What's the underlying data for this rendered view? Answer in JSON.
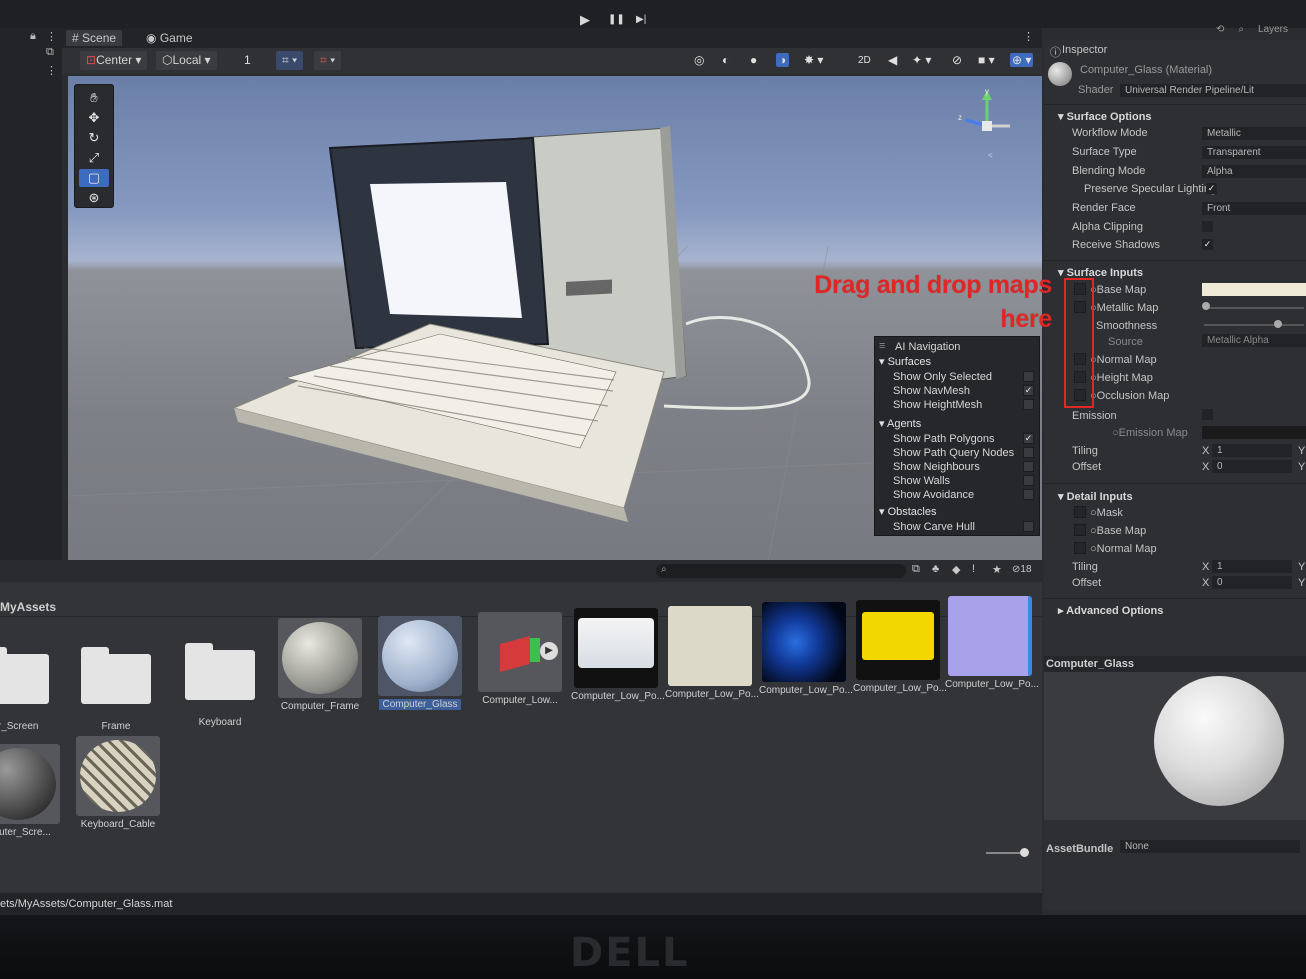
{
  "toolbar_top": {
    "play": "▶",
    "pause": "❚❚",
    "step": "▶|",
    "layers": "Layers"
  },
  "tabs": {
    "scene": "Scene",
    "game": "Game"
  },
  "scene_toolbar": {
    "pivot": "Center",
    "space": "Local",
    "grid_value": "1",
    "mode_2d": "2D"
  },
  "ai_navigation": {
    "title": "AI Navigation",
    "surfaces": "Surfaces",
    "surface_items": [
      {
        "label": "Show Only Selected",
        "checked": false
      },
      {
        "label": "Show NavMesh",
        "checked": true
      },
      {
        "label": "Show HeightMesh",
        "checked": false
      }
    ],
    "agents": "Agents",
    "agent_items": [
      {
        "label": "Show Path Polygons",
        "checked": true
      },
      {
        "label": "Show Path Query Nodes",
        "checked": false
      },
      {
        "label": "Show Neighbours",
        "checked": false
      },
      {
        "label": "Show Walls",
        "checked": false
      },
      {
        "label": "Show Avoidance",
        "checked": false
      }
    ],
    "obstacles": "Obstacles",
    "obstacle_items": [
      {
        "label": "Show Carve Hull",
        "checked": false
      }
    ]
  },
  "annotation": {
    "line1": "Drag and drop maps",
    "line2": "here",
    "color": "#e12626"
  },
  "inspector": {
    "title": "Inspector",
    "material_name": "Computer_Glass (Material)",
    "shader_label": "Shader",
    "shader_value": "Universal Render Pipeline/Lit",
    "surface_options": "Surface Options",
    "workflow_mode": {
      "label": "Workflow Mode",
      "value": "Metallic"
    },
    "surface_type": {
      "label": "Surface Type",
      "value": "Transparent"
    },
    "blending_mode": {
      "label": "Blending Mode",
      "value": "Alpha"
    },
    "preserve_specular": {
      "label": "Preserve Specular Lighting",
      "checked": true
    },
    "render_face": {
      "label": "Render Face",
      "value": "Front"
    },
    "alpha_clipping": {
      "label": "Alpha Clipping",
      "checked": false
    },
    "receive_shadows": {
      "label": "Receive Shadows",
      "checked": true
    },
    "surface_inputs": "Surface Inputs",
    "base_map": "Base Map",
    "metallic_map": "Metallic Map",
    "smoothness": "Smoothness",
    "source_label": "Source",
    "source_value": "Metallic Alpha",
    "normal_map": "Normal Map",
    "height_map": "Height Map",
    "occlusion_map": "Occlusion Map",
    "emission": "Emission",
    "emission_map": "Emission Map",
    "tiling": {
      "label": "Tiling",
      "x": "1"
    },
    "offset": {
      "label": "Offset",
      "x": "0"
    },
    "detail_inputs": "Detail Inputs",
    "mask": "Mask",
    "detail_base_map": "Base Map",
    "detail_normal_map": "Normal Map",
    "detail_tiling": {
      "label": "Tiling",
      "x": "1"
    },
    "detail_offset": {
      "label": "Offset",
      "x": "0"
    },
    "advanced_options": "Advanced Options",
    "preview_name": "Computer_Glass",
    "assetbundle_label": "AssetBundle",
    "assetbundle_value": "None",
    "x_label": "X",
    "y_label": "Y"
  },
  "project": {
    "search_count": "18",
    "folder_title": "MyAssets",
    "assets_row1": [
      {
        "name": "ter_Screen",
        "kind": "folder"
      },
      {
        "name": "Frame",
        "kind": "folder"
      },
      {
        "name": "Keyboard",
        "kind": "folder"
      },
      {
        "name": "Computer_Frame",
        "kind": "material"
      },
      {
        "name": "Computer_Glass",
        "kind": "material-selected"
      },
      {
        "name": "Computer_Low...",
        "kind": "prefab"
      },
      {
        "name": "Computer_Low_Po...",
        "kind": "texture-white"
      },
      {
        "name": "Computer_Low_Po...",
        "kind": "texture-cream"
      },
      {
        "name": "Computer_Low_Po...",
        "kind": "texture-blue"
      },
      {
        "name": "Computer_Low_Po...",
        "kind": "texture-yellow"
      },
      {
        "name": "Computer_Low_Po...",
        "kind": "texture-normal"
      }
    ],
    "assets_row2": [
      {
        "name": "mputer_Scre...",
        "kind": "material-dark"
      },
      {
        "name": "Keyboard_Cable",
        "kind": "material-pattern"
      }
    ],
    "path": "ets/MyAssets/Computer_Glass.mat"
  },
  "bezel_brand": "DELL"
}
